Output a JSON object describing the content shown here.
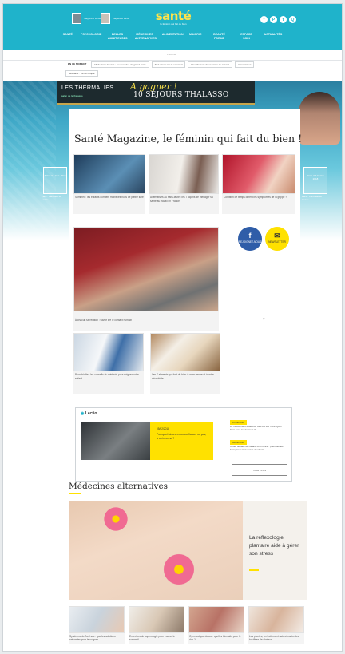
{
  "header": {
    "mag1_caption": "magazine santé",
    "mag2_caption": "magazine santé",
    "logo_text": "santé",
    "logo_tagline": "le féminin qui fait du bien",
    "social": [
      "f",
      "P",
      "t",
      "Q"
    ],
    "nav": [
      "SANTÉ",
      "PSYCHOLOGIE",
      "BELLES AMBITIEUSES",
      "MÉDECINES ALTERNATIVES",
      "ALIMENTATION",
      "MAIGRIR",
      "BEAUTÉ FORME",
      "ESPACE SOIN",
      "ACTUALITÉS"
    ]
  },
  "tagbar": {
    "label": "Publicité"
  },
  "subnav": {
    "items": [
      "EN CE MOMENT",
      "Médecines douces : les remèdes de grand-mère",
      "Tout savoir sur le sommeil",
      "Prendre soin de sa santé au naturel",
      "Alimentation",
      "Sexualité : vie de couple"
    ]
  },
  "banner": {
    "brand": "LES THERMALIES",
    "brand_sub": "salon de la thalasso",
    "promo_1": "A gagner !",
    "promo_2": "10 SÉJOURS THALASSO"
  },
  "side": {
    "left_box": "Salon 3-5 févr. 2018",
    "right_box": "Paris 3-4 février 2018",
    "left_caption": "Paris · Carrousel du Louvre",
    "right_caption": "Paris · Carrousel du Louvre"
  },
  "page": {
    "headline": "Santé Magazine, le féminin qui fait du bien !"
  },
  "cards_top": [
    "Sommeil : les enfants dorment moins les nuits de pleine lune",
    "Alternatives au sans-faute : les 7 façons de ménager sa santé au travail en France",
    "Combien de temps durent les symptômes de la grippe ?"
  ],
  "main_story": {
    "caption": "À chacun sa relation : savoir lire le contact humain"
  },
  "social_buttons": {
    "facebook": "REJOIGNEZ-NOUS",
    "newsletter": "NEWSLETTER"
  },
  "cards_mid": [
    "Bronchiolite : les conseils du médecin pour soigner votre enfant",
    "Les 7 aliments qui font du bien à votre ventre et à votre microbiote"
  ],
  "live": {
    "title": "Lectio",
    "date": "05/02/2018",
    "headline": "Pourquoi faisons-nous confiance, ou pas, à un inconnu ?",
    "events": [
      {
        "date": "07/02/2018",
        "text": "Le mouvement #BalanceTonPorc a 6 mois. Quel bilan pour les femmes ?"
      },
      {
        "date": "06/02/2018",
        "text": "Chute du taux de natalité en France : pourquoi les Françaises font moins d'enfants"
      }
    ],
    "more_button": "VOIR PLUS"
  },
  "section": {
    "title": "Médecines alternatives",
    "feature_caption": "La réflexologie plantaire aide à gérer son stress"
  },
  "cards_bottom": [
    "Syndrome de l'œil sec : quelles solutions naturelles pour le soigner",
    "Exercices de sophrologie pour trouver le sommeil",
    "Gymnastique douce : quelles bienfaits pour le dos ?",
    "Les plantes, un traitement naturel contre les bouffées de chaleur"
  ]
}
